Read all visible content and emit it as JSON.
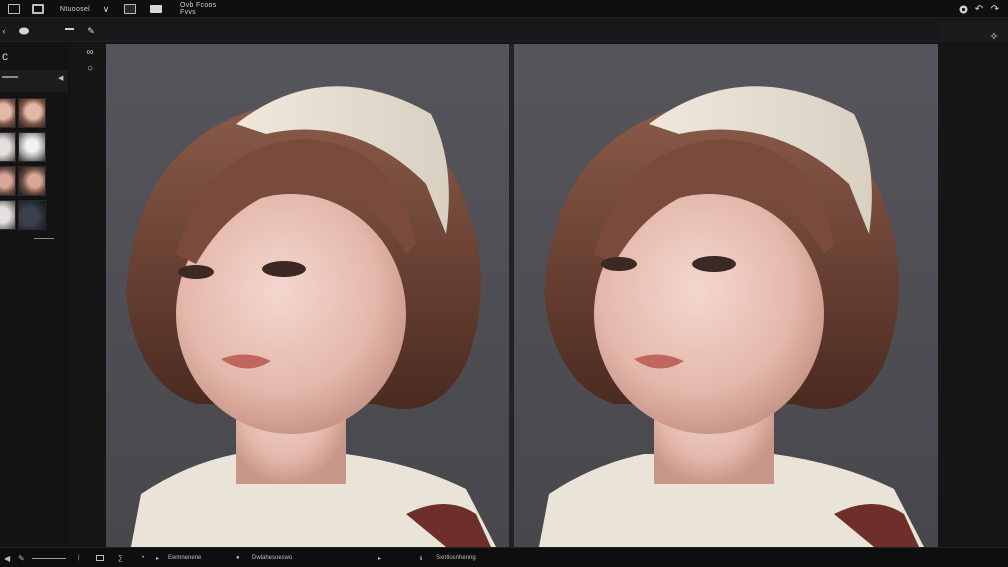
{
  "topbar": {
    "items": [
      {
        "kind": "icon",
        "name": "window-icon"
      },
      {
        "kind": "icon",
        "name": "layers-icon"
      },
      {
        "kind": "text",
        "label": "Ntuoosel"
      },
      {
        "kind": "icon",
        "name": "chevron-down-icon"
      },
      {
        "kind": "icon",
        "name": "image-icon"
      },
      {
        "kind": "icon",
        "name": "frame-icon"
      },
      {
        "kind": "text",
        "label": "Ovb Fcoos Fvvs"
      }
    ],
    "right_icons": [
      "settings-icon",
      "undo-icon",
      "redo-icon"
    ]
  },
  "canvas": {
    "left_label": "",
    "right_label": ""
  },
  "bottombar": {
    "labels": [
      "Ewmnenene",
      "Dwlahesoeswo",
      "Sxntlosnhenng"
    ]
  }
}
